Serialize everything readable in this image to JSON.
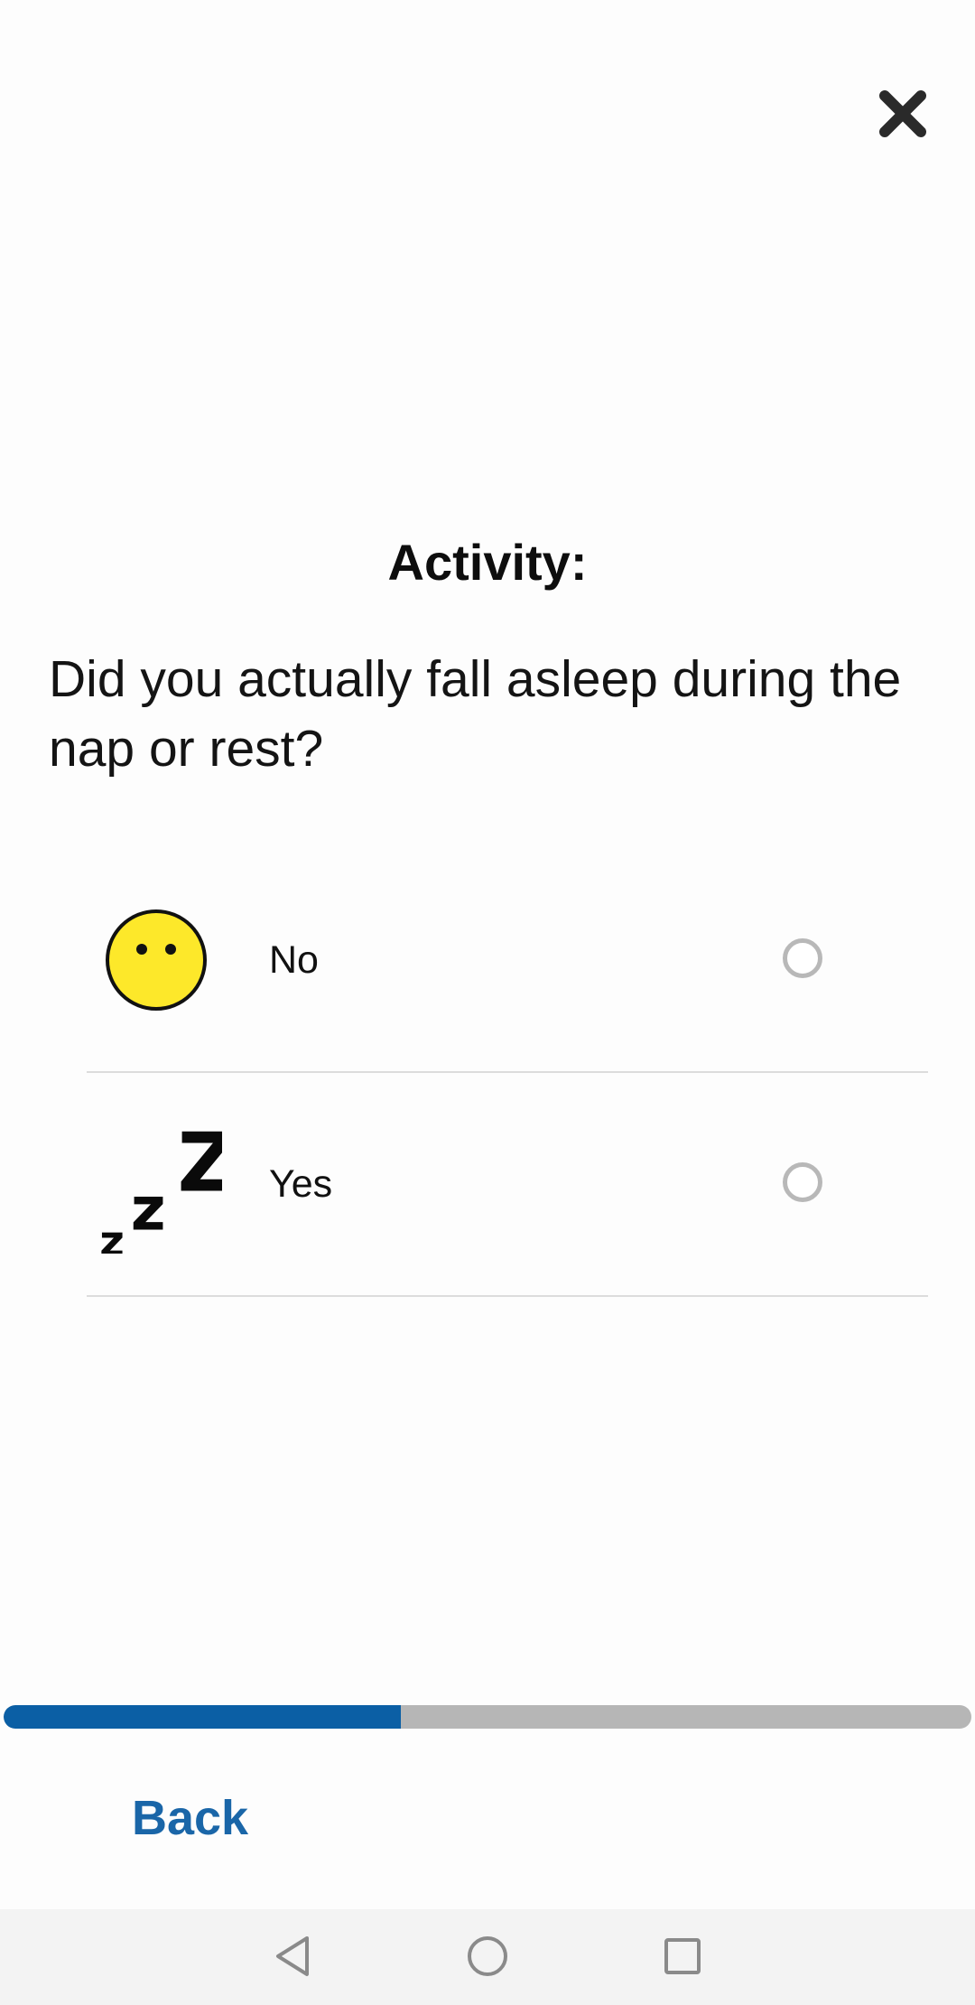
{
  "header": {
    "close_icon": "close-x-icon"
  },
  "section": {
    "title": "Activity:"
  },
  "question": {
    "text": "Did you actually fall asleep during the nap or rest?"
  },
  "options": [
    {
      "label": "No",
      "icon": "neutral-face-icon",
      "selected": false
    },
    {
      "label": "Yes",
      "icon": "sleep-zzz-icon",
      "selected": false
    }
  ],
  "progress": {
    "fraction": 0.41,
    "fill_color": "#0b5fa5",
    "track_color": "#b6b6b6"
  },
  "footer": {
    "back_label": "Back",
    "accent_color": "#1a66a8"
  },
  "system_nav": {
    "back_icon": "nav-back-triangle-icon",
    "home_icon": "nav-home-circle-icon",
    "recents_icon": "nav-recents-square-icon"
  }
}
